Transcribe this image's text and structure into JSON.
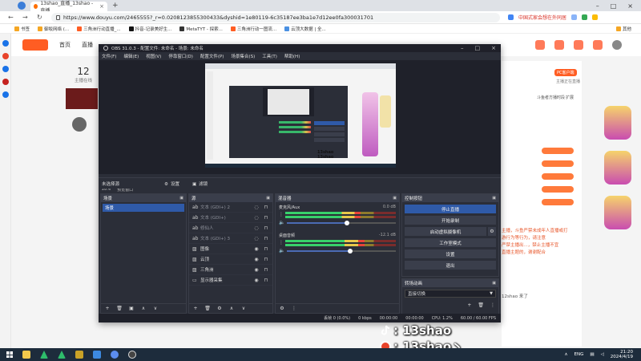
{
  "browser": {
    "tab_title": "13shao_直播_13shao - 直播",
    "url": "https://www.douyu.com/2465555?_r=0.0208123855300433&dyshid=1e80119-6c35187ee3ba1e7d12ee0fa300031701",
    "right_ext_text": "中国式家会想在外同居",
    "bookmarks": [
      "书签",
      "御坂网络 (...",
      "三角洲行动直播_...",
      "抖音-记录美好生...",
      "MetaTYT - 探索...",
      "三角洲行动一图流...",
      "云顶大数据 | 全...",
      "其他"
    ]
  },
  "douyu": {
    "nav_home": "首页",
    "nav_second": "直播",
    "followed_count": "12",
    "followed_label": "主播在线",
    "right_labels": [
      "PC客户端",
      "主播正在直播",
      "斗鱼者方播时段",
      "扩展"
    ],
    "chat_lines": [
      "主播，斗鱼严禁未成年人直播或打",
      "游行为等行为，请注意",
      "严禁主播出...，禁止主播不宜",
      "直播主题的，谢谢配合"
    ],
    "chat_user": "12shao",
    "chat_msg": "来了"
  },
  "obs": {
    "title": "OBS 31.0.3 - 配置文件: 未命名 - 场景: 未命名",
    "menu": [
      "文件(F)",
      "编辑(E)",
      "视图(V)",
      "停靠窗口(D)",
      "配置文件(P)",
      "场景集合(S)",
      "工具(T)",
      "帮助(H)"
    ],
    "zoom": "28%",
    "zoom_hint": "预览窗口",
    "no_source": "未选择源",
    "settings_btn": "设置",
    "filter_btn": "滤镜",
    "panels": {
      "scenes": "场景",
      "sources": "源",
      "mixer": "混音器",
      "controls": "控制按钮",
      "transitions": "转场动画"
    },
    "scenes": [
      "场景"
    ],
    "sources": [
      {
        "icon": "text-icon",
        "name": "文本 (GDI+) 2",
        "dim": true
      },
      {
        "icon": "text-icon",
        "name": "文本 (GDI+)",
        "dim": true
      },
      {
        "icon": "text-icon",
        "name": "修仙人",
        "dim": true
      },
      {
        "icon": "text-icon",
        "name": "文本 (GDI+) 3",
        "dim": true
      },
      {
        "icon": "image-icon",
        "name": "图像",
        "dim": false
      },
      {
        "icon": "image-icon",
        "name": "云顶",
        "dim": false
      },
      {
        "icon": "image-icon",
        "name": "三角洲",
        "dim": false
      },
      {
        "icon": "monitor-icon",
        "name": "显示器采集",
        "dim": false
      }
    ],
    "mixer": [
      {
        "name": "麦克风/Aux",
        "db": "0.0 dB",
        "level": 0.68,
        "volume": 0.55
      },
      {
        "name": "桌面音频",
        "db": "-12.1 dB",
        "level": 0.72,
        "volume": 0.58
      }
    ],
    "controls": [
      "停止直播",
      "开始录制",
      "启动虚拟摄像机",
      "工作室模式",
      "设置",
      "退出"
    ],
    "transition_value": "直接切换",
    "status": {
      "frames": "丢帧 0 (0.0%)",
      "kbps": "0 kbps",
      "stream_time": "00:00:00",
      "rec_time": "00:00:00",
      "cpu": "CPU: 1.2%",
      "fps": "60.00 / 60.00 FPS"
    },
    "preview_brand": [
      "13shao",
      "13shao"
    ]
  },
  "watermark": {
    "line1": ": 13shao",
    "line2": ": 13shao丶"
  },
  "taskbar": {
    "lang": "ENG",
    "time": "21:20",
    "date": "2024/4/19"
  },
  "colors": {
    "obs_bg": "#2b2e38",
    "obs_accent": "#2f5aa8",
    "douyu_orange": "#ff5d23"
  }
}
